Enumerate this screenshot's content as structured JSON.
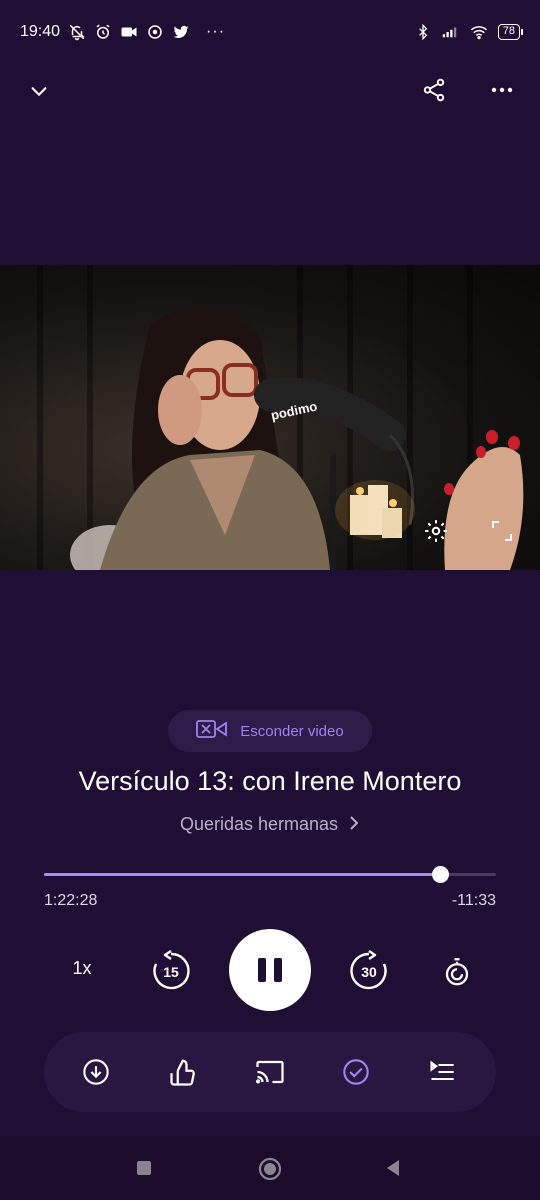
{
  "status_bar": {
    "time": "19:40",
    "battery": "78",
    "more": "···",
    "left_icons": [
      "bell-off-icon",
      "alarm-icon",
      "video-camera-icon",
      "media-icon",
      "twitter-icon",
      "more-dots-icon"
    ],
    "right_icons": [
      "bluetooth-icon",
      "signal-icon",
      "wifi-icon",
      "battery-icon"
    ]
  },
  "top_bar": {
    "icons": [
      "chevron-down-icon",
      "share-icon",
      "more-icon"
    ]
  },
  "video": {
    "brand_text": "podimo",
    "icons": [
      "settings-icon",
      "fullscreen-icon"
    ]
  },
  "player": {
    "hide_video_label": "Esconder video",
    "episode_title": "Versículo 13: con Irene Montero",
    "podcast_name": "Queridas hermanas",
    "progress": 0.875,
    "elapsed": "1:22:28",
    "remaining": "-11:33",
    "speed": "1x",
    "skip_back_seconds": "15",
    "skip_forward_seconds": "30"
  },
  "action_bar": {
    "icons": [
      "download-icon",
      "thumbs-up-icon",
      "cast-icon",
      "check-circle-icon",
      "queue-icon"
    ]
  },
  "colors": {
    "background": "#200f34",
    "accent": "#a78bfa",
    "accent_text": "#9b86f0"
  }
}
